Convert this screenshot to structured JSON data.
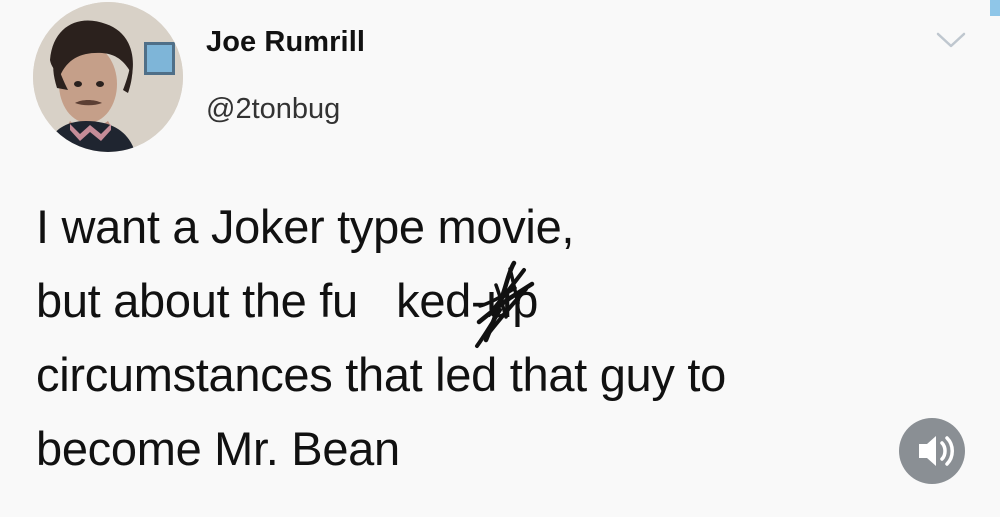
{
  "tweet": {
    "author": {
      "display_name": "Joe Rumrill",
      "handle": "@2tonbug"
    },
    "text_lines": [
      "I want a Joker type movie,",
      "but about the fu   ked-up",
      "circumstances that led that guy to",
      "become Mr. Bean"
    ]
  },
  "icons": {
    "menu": "chevron-down-icon",
    "sound": "speaker-icon"
  },
  "colors": {
    "background": "#f9f9f9",
    "accent": "#8fc6e8",
    "sound_button": "#8a8f94"
  }
}
